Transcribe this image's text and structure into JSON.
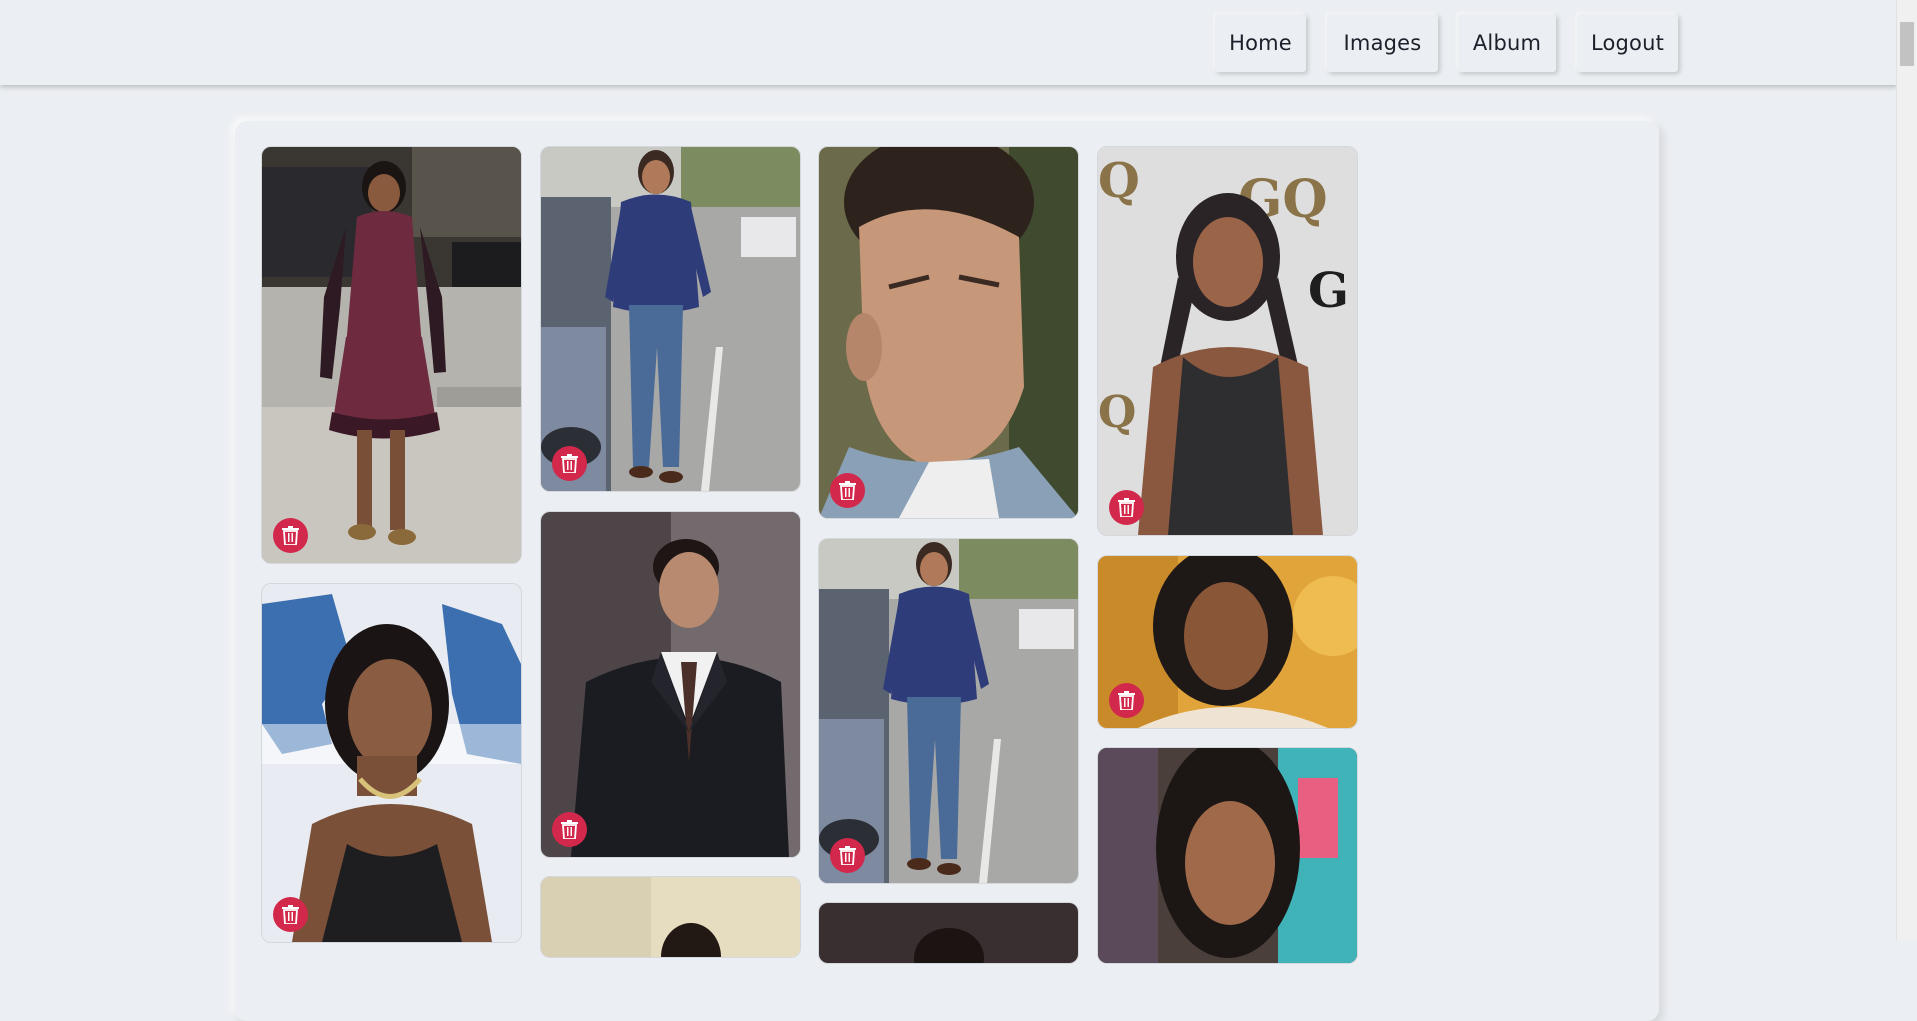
{
  "nav": {
    "home": "Home",
    "images": "Images",
    "album": "Album",
    "logout": "Logout"
  },
  "colors": {
    "background": "#ebeef2",
    "delete_button": "#d2284b",
    "nav_text": "#1d1f2b"
  },
  "gallery": {
    "columns": [
      [
        "photo-woman-purple-dress",
        "photo-woman-black-top-autism-event"
      ],
      [
        "photo-man-walking-street",
        "photo-man-black-suit",
        "photo-man-partial"
      ],
      [
        "photo-man-closeup",
        "photo-man-walking-street",
        "photo-man-partial-dark"
      ],
      [
        "photo-woman-gq-event",
        "photo-woman-smiling-closeup",
        "photo-woman-colorful-backdrop"
      ]
    ],
    "delete_icon": "trash-icon"
  }
}
